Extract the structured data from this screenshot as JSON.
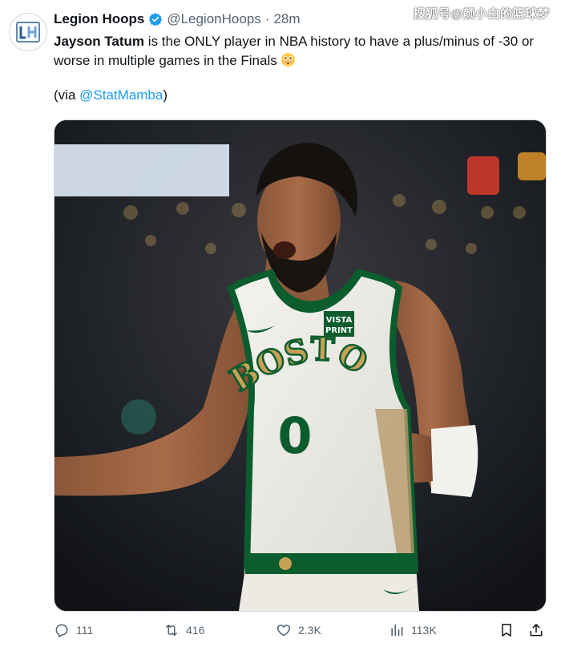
{
  "watermark": "搜狐号@颜小白的篮球梦",
  "author": {
    "display_name": "Legion Hoops",
    "handle": "@LegionHoops",
    "separator": "·",
    "time": "28m"
  },
  "tweet": {
    "bold_name": "Jayson Tatum",
    "body": " is the ONLY player in NBA history to have a plus/minus of -30 or worse in multiple games in the Finals ",
    "via_prefix": "(via ",
    "via_mention": "@StatMamba",
    "via_suffix": ")"
  },
  "media": {
    "jersey_team": "BOSTON",
    "jersey_number": "0",
    "jersey_sponsor_line1": "VISTA",
    "jersey_sponsor_line2": "PRINT"
  },
  "actions": {
    "replies": "111",
    "retweets": "416",
    "likes": "2.3K",
    "views": "113K"
  },
  "icons": {
    "verified": "verified-badge-icon",
    "reply": "reply-icon",
    "retweet": "retweet-icon",
    "like": "heart-icon",
    "views": "views-chart-icon",
    "bookmark": "bookmark-icon",
    "share": "share-icon",
    "emoji": "flushed-face-emoji"
  },
  "colors": {
    "link": "#1d9bf0",
    "muted": "#536471",
    "text": "#0f1419",
    "celtics_green": "#0b5d2e"
  }
}
